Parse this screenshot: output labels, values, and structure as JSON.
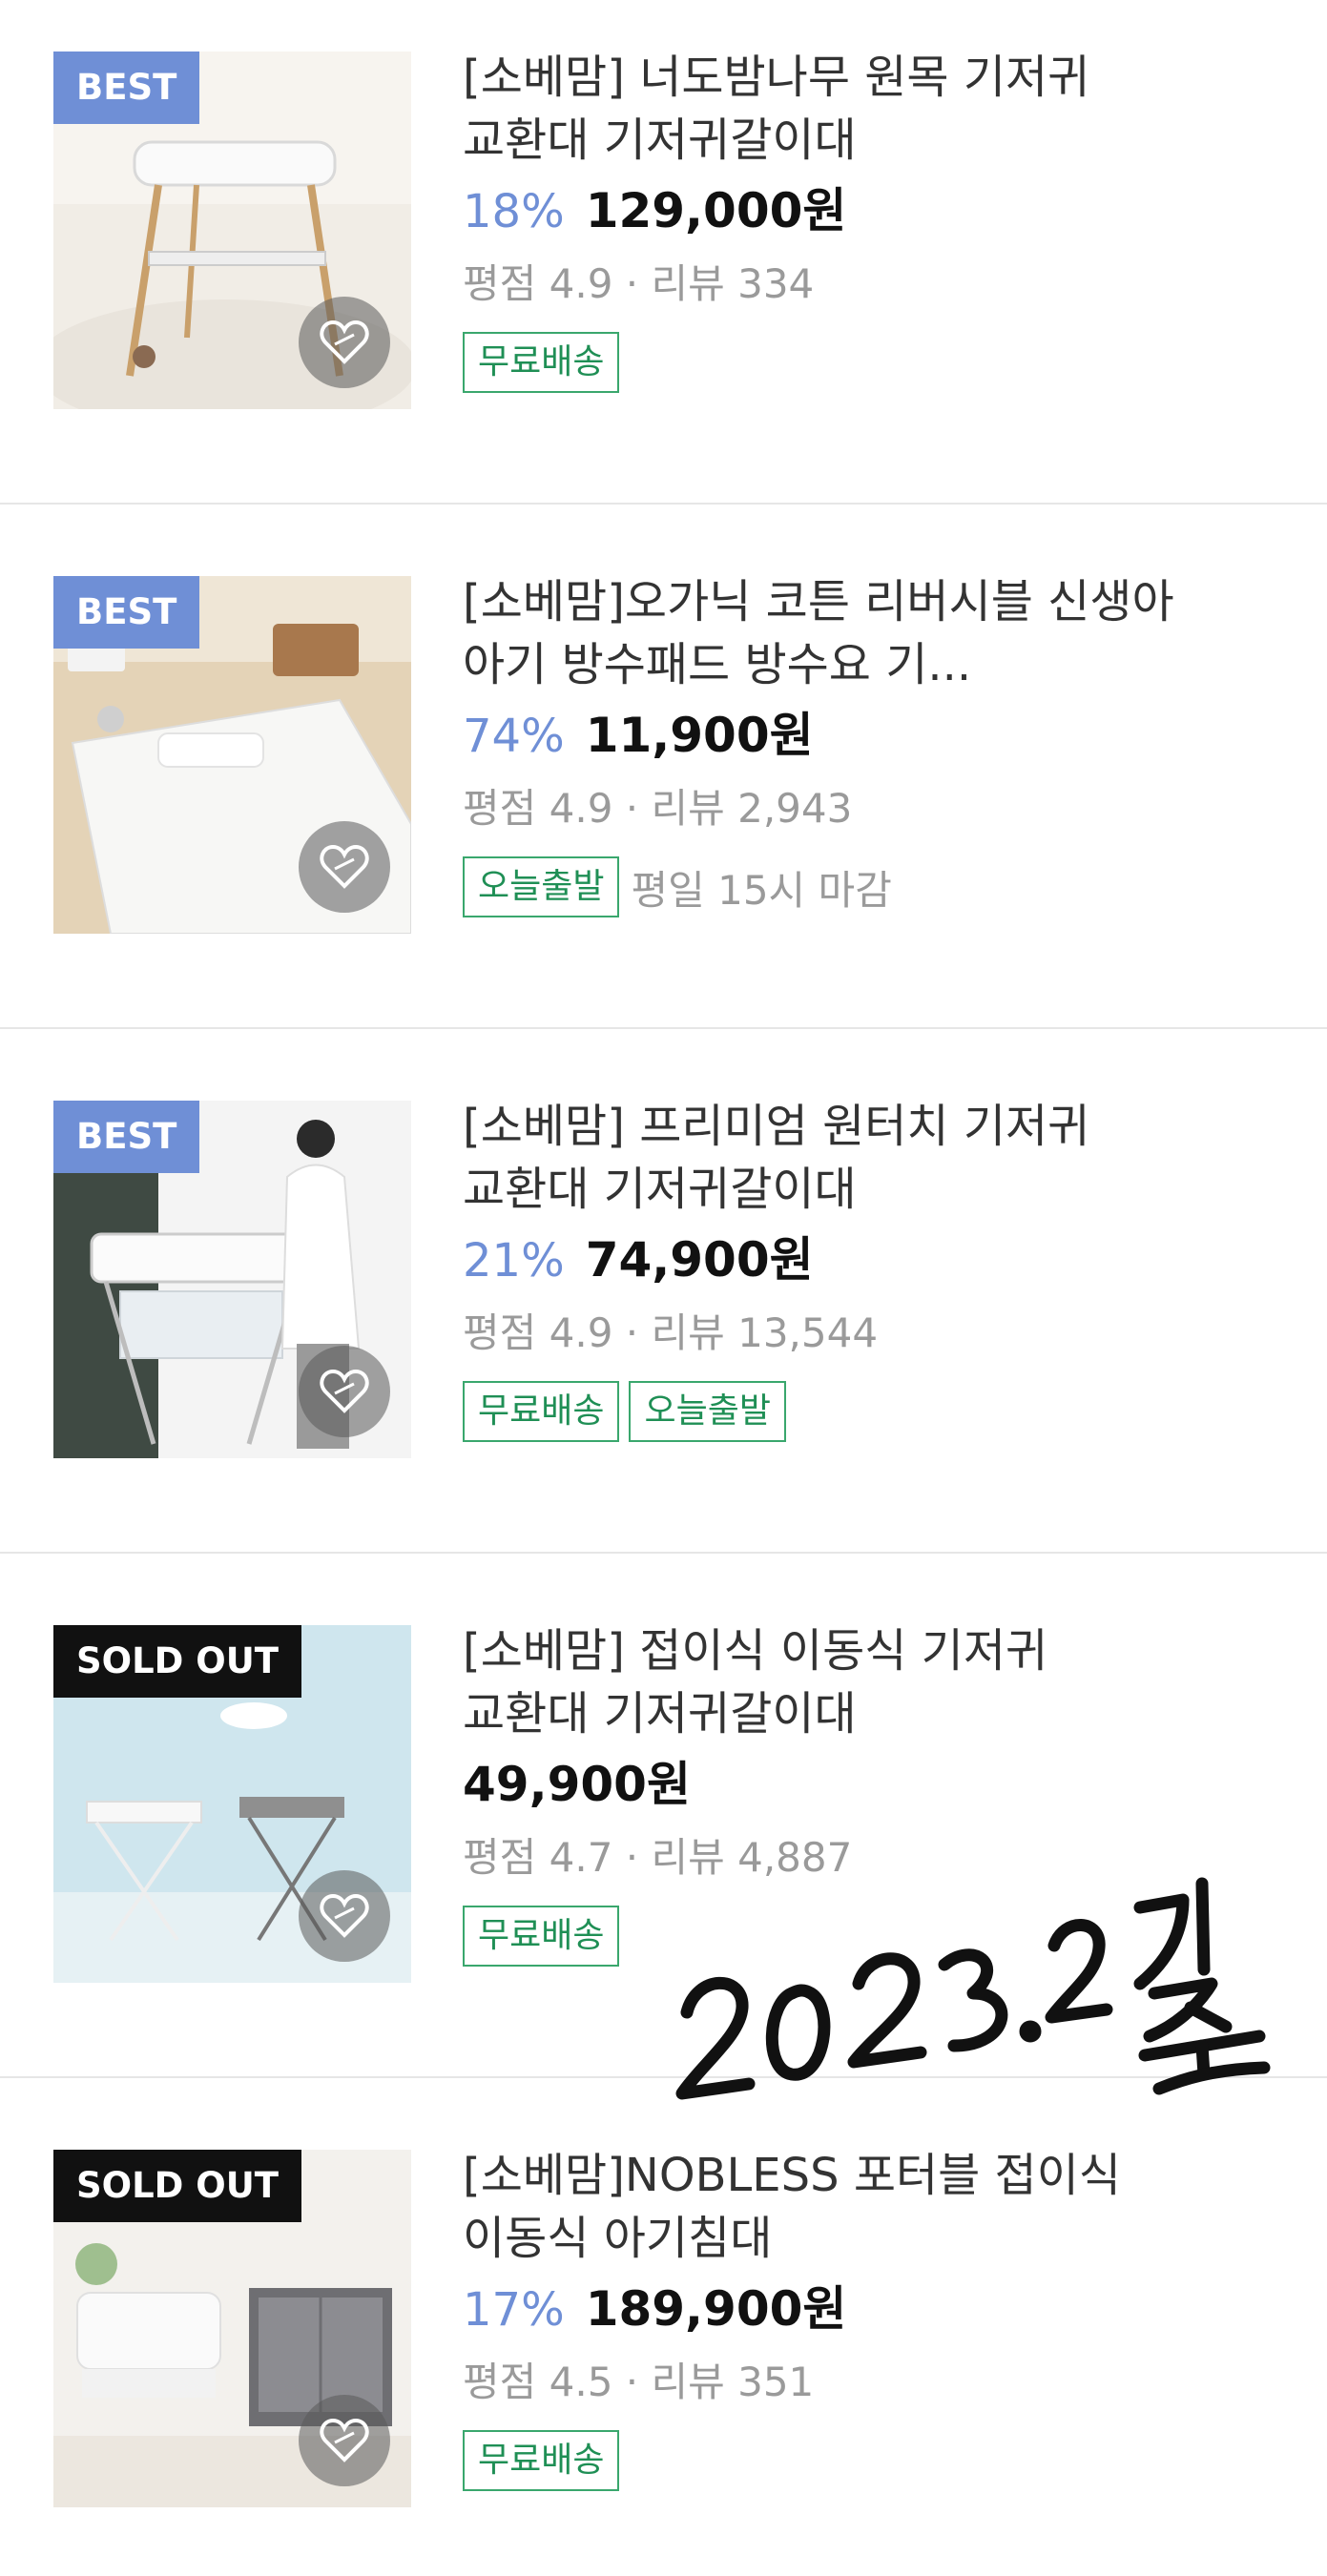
{
  "products": [
    {
      "badge": "BEST",
      "badge_type": "best",
      "title": "[소베맘] 너도밤나무 원목 기저귀 교환대 기저귀갈이대",
      "discount": "18%",
      "price": "129,000원",
      "rating_text": "평점 4.9 · 리뷰 334",
      "tags": [
        "무료배송"
      ],
      "deadline": "",
      "image_icon": "wooden-changing-table-photo"
    },
    {
      "badge": "BEST",
      "badge_type": "best",
      "title": "[소베맘]오가닉 코튼 리버시블 신생아 아기 방수패드 방수요 기...",
      "discount": "74%",
      "price": "11,900원",
      "rating_text": "평점 4.9 · 리뷰 2,943",
      "tags": [
        "오늘출발"
      ],
      "deadline": "평일 15시 마감",
      "image_icon": "waterproof-pad-photo"
    },
    {
      "badge": "BEST",
      "badge_type": "best",
      "title": "[소베맘] 프리미엄 원터치 기저귀 교환대 기저귀갈이대",
      "discount": "21%",
      "price": "74,900원",
      "rating_text": "평점 4.9 · 리뷰 13,544",
      "tags": [
        "무료배송",
        "오늘출발"
      ],
      "deadline": "",
      "image_icon": "folding-changing-table-photo"
    },
    {
      "badge": "SOLD OUT",
      "badge_type": "soldout",
      "title": "[소베맘] 접이식 이동식 기저귀 교환대 기저귀갈이대",
      "discount": "",
      "price": "49,900원",
      "rating_text": "평점 4.7 · 리뷰 4,887",
      "tags": [
        "무료배송"
      ],
      "deadline": "",
      "image_icon": "portable-changing-table-photo"
    },
    {
      "badge": "SOLD OUT",
      "badge_type": "soldout",
      "title": "[소베맘]NOBLESS 포터블 접이식 이동식 아기침대",
      "discount": "17%",
      "price": "189,900원",
      "rating_text": "평점 4.5 · 리뷰 351",
      "tags": [
        "무료배송"
      ],
      "deadline": "",
      "image_icon": "portable-crib-photo"
    }
  ],
  "annotation": "2023.2 기준",
  "colors": {
    "accent_blue": "#6f8fd6",
    "tag_green": "#1f8f55",
    "soldout_black": "#111111"
  }
}
